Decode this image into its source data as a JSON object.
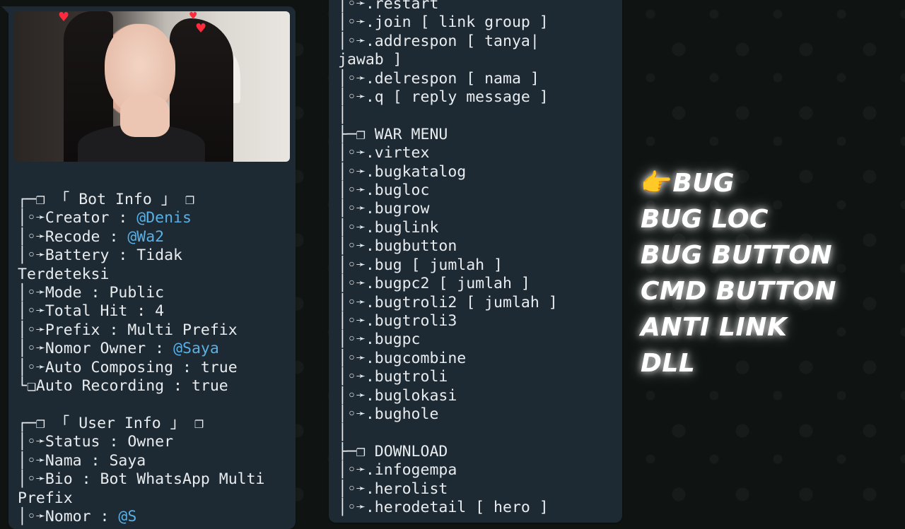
{
  "left_message": {
    "bot_info": {
      "header": "┌─❐ 「 Bot Info 」 ❐",
      "creator_label": "│◦➛Creator : ",
      "creator_value": "@Denis",
      "recode_label": "│◦➛Recode : ",
      "recode_value": "@Wa2",
      "battery_line": "│◦➛Battery : Tidak",
      "battery_wrap": "Terdeteksi",
      "mode": "│◦➛Mode : Public",
      "total_hit": "│◦➛Total Hit : 4",
      "prefix": "│◦➛Prefix : Multi Prefix",
      "owner_label": "│◦➛Nomor Owner : ",
      "owner_value": "@Saya",
      "auto_composing": "│◦➛Auto Composing : true",
      "auto_recording": "└❏Auto Recording : true"
    },
    "user_info": {
      "header": "┌─❐ 「 User Info 」 ❐",
      "status": "│◦➛Status : Owner",
      "nama": "│◦➛Nama : Saya",
      "bio_line": "│◦➛Bio : Bot WhatsApp Multi",
      "bio_wrap": "Prefix",
      "partial_label": "│◦➛Nomor : ",
      "partial_value": "@S"
    }
  },
  "right_message": {
    "lines": [
      "│◦➛.restart",
      "│◦➛.join [ link group ]",
      "│◦➛.addrespon [ tanya|",
      "jawab ]",
      "│◦➛.delrespon [ nama ]",
      "│◦➛.q [ reply message ]",
      "│",
      "├─❐ WAR MENU",
      "│◦➛.virtex",
      "│◦➛.bugkatalog",
      "│◦➛.bugloc",
      "│◦➛.bugrow",
      "│◦➛.buglink",
      "│◦➛.bugbutton",
      "│◦➛.bug [ jumlah ]",
      "│◦➛.bugpc2 [ jumlah ]",
      "│◦➛.bugtroli2 [ jumlah ]",
      "│◦➛.bugtroli3",
      "│◦➛.bugpc",
      "│◦➛.bugcombine",
      "│◦➛.bugtroli",
      "│◦➛.buglokasi",
      "│◦➛.bughole",
      "│",
      "├─❐ DOWNLOAD",
      "│◦➛.infogempa",
      "│◦➛.herolist",
      "│◦➛.herodetail [ hero ]"
    ]
  },
  "overlay_text": {
    "pointer": "👉",
    "line1": "BUG",
    "line2": "BUG LOC",
    "line3": "BUG BUTTON",
    "line4": "CMD BUTTON",
    "line5": "ANTI LINK",
    "line6": "DLL"
  },
  "colors": {
    "background": "#0f1412",
    "bubble": "#1e2a33",
    "text": "#e8ecef",
    "mention": "#59b0e6",
    "heart": "#ff2a3d"
  }
}
